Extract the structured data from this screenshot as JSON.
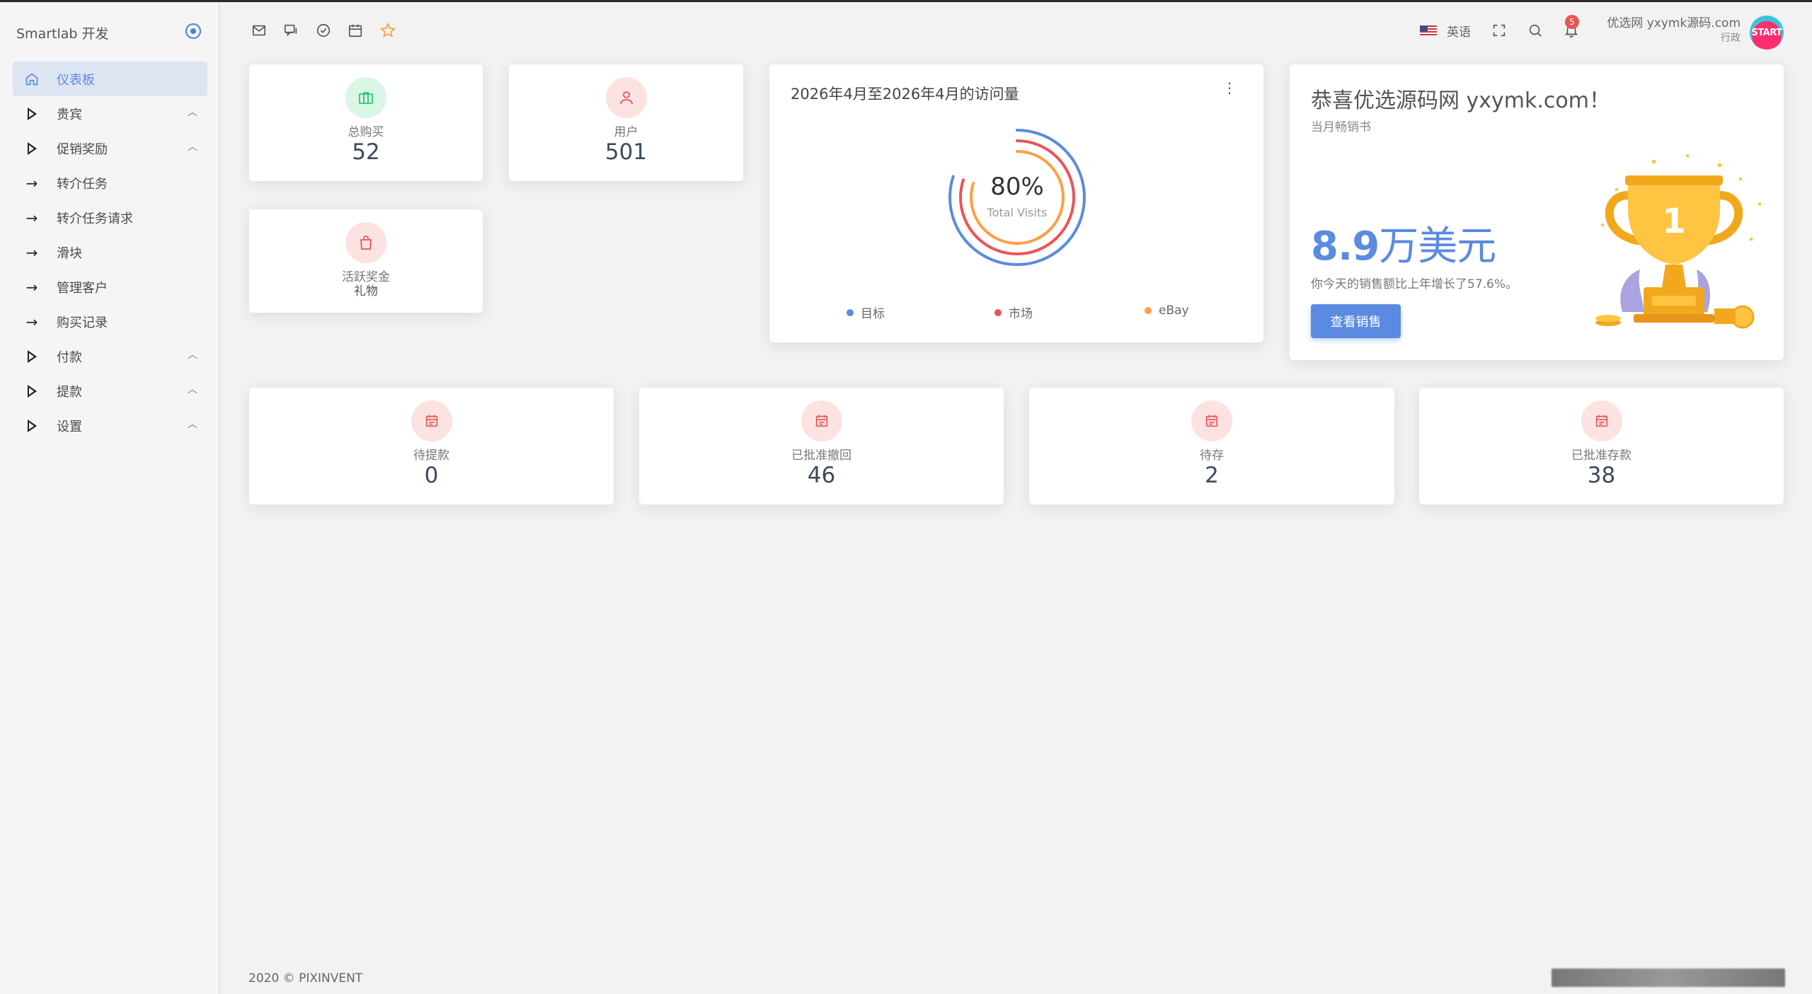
{
  "sidebar": {
    "brand": "Smartlab 开发",
    "items": [
      {
        "label": "仪表板",
        "icon": "home-icon",
        "active": true
      },
      {
        "label": "贵宾",
        "icon": "triangle-icon",
        "chevron": true
      },
      {
        "label": "促销奖励",
        "icon": "triangle-icon",
        "chevron": true
      },
      {
        "label": "转介任务",
        "icon": "arrow-right-icon"
      },
      {
        "label": "转介任务请求",
        "icon": "arrow-right-icon"
      },
      {
        "label": "滑块",
        "icon": "arrow-right-icon"
      },
      {
        "label": "管理客户",
        "icon": "arrow-right-icon"
      },
      {
        "label": "购买记录",
        "icon": "arrow-right-icon"
      },
      {
        "label": "付款",
        "icon": "triangle-icon",
        "chevron": true
      },
      {
        "label": "提款",
        "icon": "triangle-icon",
        "chevron": true
      },
      {
        "label": "设置",
        "icon": "triangle-icon",
        "chevron": true
      }
    ]
  },
  "header": {
    "language": "英语",
    "notification_count": "5",
    "user_name": "优选网 yxymk源码.com",
    "user_role": "行政",
    "avatar_text": "START"
  },
  "stats_top": [
    {
      "label": "总购买",
      "value": "52"
    },
    {
      "label": "用户",
      "value": "501"
    }
  ],
  "bonus_card": {
    "label1": "活跃奖金",
    "label2": "礼物"
  },
  "visits": {
    "title": "2026年4月至2026年4月的访问量",
    "percent": "80%",
    "caption": "Total Visits",
    "legend": [
      {
        "label": "目标",
        "color": "#5b8be0"
      },
      {
        "label": "市场",
        "color": "#ea5455"
      },
      {
        "label": "eBay",
        "color": "#ff9f43"
      }
    ],
    "rings": [
      0.8,
      0.8,
      0.8
    ]
  },
  "congrats": {
    "title": "恭喜优选源码网 yxymk.com！",
    "subtitle": "当月畅销书",
    "amount_number": "8.9",
    "amount_unit": "万美元",
    "growth": "你今天的销售额比上年增长了57.6%。",
    "button": "查看销售",
    "trophy_number": "1"
  },
  "stats_bottom": [
    {
      "label": "待提款",
      "value": "0"
    },
    {
      "label": "已批准撤回",
      "value": "46"
    },
    {
      "label": "待存",
      "value": "2"
    },
    {
      "label": "已批准存款",
      "value": "38"
    }
  ],
  "footer": "2020 © PIXINVENT",
  "colors": {
    "primary": "#5b8be0",
    "danger": "#ea5455",
    "warning": "#ff9f43",
    "success": "#28c76f"
  }
}
